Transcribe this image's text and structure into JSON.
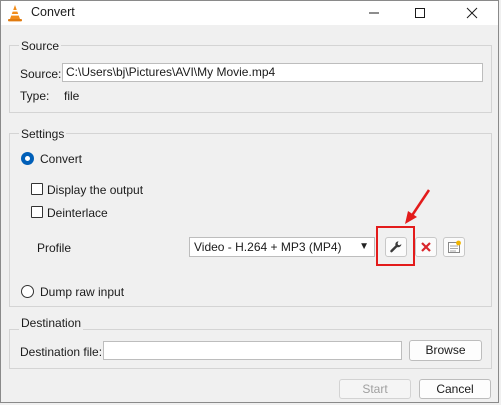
{
  "window": {
    "title": "Convert"
  },
  "source": {
    "group_title": "Source",
    "source_label": "Source:",
    "source_value": "C:\\Users\\bj\\Pictures\\AVI\\My Movie.mp4",
    "type_label": "Type:",
    "type_value": "file"
  },
  "settings": {
    "group_title": "Settings",
    "convert_label": "Convert",
    "display_output_label": "Display the output",
    "deinterlace_label": "Deinterlace",
    "profile_label": "Profile",
    "profile_selected": "Video - H.264 + MP3 (MP4)",
    "dump_raw_label": "Dump raw input"
  },
  "destination": {
    "group_title": "Destination",
    "dest_file_label": "Destination file:",
    "dest_file_value": "",
    "browse_label": "Browse"
  },
  "footer": {
    "start_label": "Start",
    "cancel_label": "Cancel"
  },
  "colors": {
    "accent": "#005fb8",
    "annotation_red": "#e31b1b",
    "vlc_orange": "#f28c1a"
  }
}
